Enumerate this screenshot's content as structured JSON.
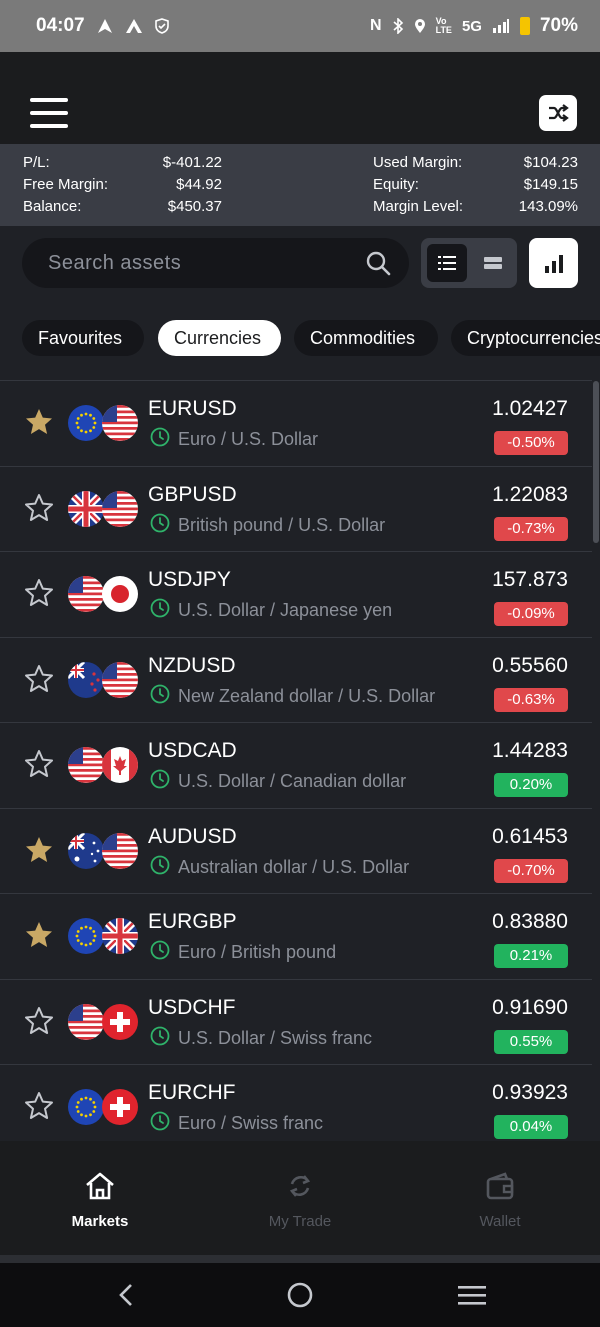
{
  "status_bar": {
    "time": "04:07",
    "network": "5G",
    "battery": "70%"
  },
  "summary": {
    "pl_label": "P/L:",
    "pl_value": "$-401.22",
    "free_margin_label": "Free Margin:",
    "free_margin_value": "$44.92",
    "balance_label": "Balance:",
    "balance_value": "$450.37",
    "used_margin_label": "Used Margin:",
    "used_margin_value": "$104.23",
    "equity_label": "Equity:",
    "equity_value": "$149.15",
    "margin_level_label": "Margin Level:",
    "margin_level_value": "143.09%"
  },
  "search": {
    "placeholder": "Search assets"
  },
  "tabs": [
    "Favourites",
    "Currencies",
    "Commodities",
    "Cryptocurrencies"
  ],
  "active_tab": "Currencies",
  "colors": {
    "negative": "#e0484b",
    "positive": "#22b35e",
    "star_filled": "#c9a865",
    "clock": "#2fb36a"
  },
  "assets": [
    {
      "symbol": "EURUSD",
      "name": "Euro / U.S. Dollar",
      "price": "1.02427",
      "change": "-0.50%",
      "favourite": true,
      "flags": [
        "eu-flag",
        "us-flag"
      ]
    },
    {
      "symbol": "GBPUSD",
      "name": "British pound / U.S. Dollar",
      "price": "1.22083",
      "change": "-0.73%",
      "favourite": false,
      "flags": [
        "uk-flag",
        "us-flag"
      ]
    },
    {
      "symbol": "USDJPY",
      "name": "U.S. Dollar / Japanese yen",
      "price": "157.873",
      "change": "-0.09%",
      "favourite": false,
      "flags": [
        "us-flag",
        "jp-flag"
      ]
    },
    {
      "symbol": "NZDUSD",
      "name": "New Zealand dollar / U.S. Dollar",
      "price": "0.55560",
      "change": "-0.63%",
      "favourite": false,
      "flags": [
        "nz-flag",
        "us-flag"
      ]
    },
    {
      "symbol": "USDCAD",
      "name": "U.S. Dollar / Canadian dollar",
      "price": "1.44283",
      "change": "0.20%",
      "favourite": false,
      "flags": [
        "us-flag",
        "ca-flag"
      ]
    },
    {
      "symbol": "AUDUSD",
      "name": "Australian dollar / U.S. Dollar",
      "price": "0.61453",
      "change": "-0.70%",
      "favourite": true,
      "flags": [
        "au-flag",
        "us-flag"
      ]
    },
    {
      "symbol": "EURGBP",
      "name": "Euro / British pound",
      "price": "0.83880",
      "change": "0.21%",
      "favourite": true,
      "flags": [
        "eu-flag",
        "uk-flag"
      ]
    },
    {
      "symbol": "USDCHF",
      "name": "U.S. Dollar / Swiss franc",
      "price": "0.91690",
      "change": "0.55%",
      "favourite": false,
      "flags": [
        "us-flag",
        "ch-flag"
      ]
    },
    {
      "symbol": "EURCHF",
      "name": "Euro / Swiss franc",
      "price": "0.93923",
      "change": "0.04%",
      "favourite": false,
      "flags": [
        "eu-flag",
        "ch-flag"
      ]
    }
  ],
  "nav": {
    "markets": "Markets",
    "my_trade": "My Trade",
    "wallet": "Wallet"
  }
}
